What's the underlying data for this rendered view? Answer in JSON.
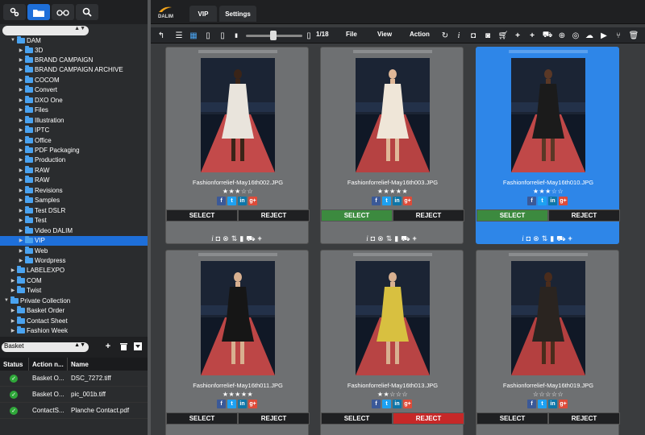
{
  "left_toolbar": {
    "icons": [
      "settings-icon",
      "folder-icon",
      "glasses-icon",
      "search-icon"
    ]
  },
  "tree": {
    "root_label": "DAM",
    "items": [
      {
        "label": "3D",
        "depth": 2
      },
      {
        "label": "BRAND CAMPAIGN",
        "depth": 2
      },
      {
        "label": "BRAND CAMPAIGN ARCHIVE",
        "depth": 2
      },
      {
        "label": "COCOM",
        "depth": 2
      },
      {
        "label": "Convert",
        "depth": 2
      },
      {
        "label": "DXO One",
        "depth": 2
      },
      {
        "label": "Files",
        "depth": 2
      },
      {
        "label": "Illustration",
        "depth": 2
      },
      {
        "label": "IPTC",
        "depth": 2
      },
      {
        "label": "Office",
        "depth": 2
      },
      {
        "label": "PDF Packaging",
        "depth": 2
      },
      {
        "label": "Production",
        "depth": 2
      },
      {
        "label": "RAW",
        "depth": 2
      },
      {
        "label": "RAW",
        "depth": 2
      },
      {
        "label": "Revisions",
        "depth": 2
      },
      {
        "label": "Samples",
        "depth": 2
      },
      {
        "label": "Test DSLR",
        "depth": 2
      },
      {
        "label": "Test",
        "depth": 2
      },
      {
        "label": "Video DALIM",
        "depth": 2
      },
      {
        "label": "VIP",
        "depth": 2,
        "selected": true
      },
      {
        "label": "Web",
        "depth": 2
      },
      {
        "label": "Wordpress",
        "depth": 2
      },
      {
        "label": "LABELEXPO",
        "depth": 1
      },
      {
        "label": "COM",
        "depth": 1
      },
      {
        "label": "Twist",
        "depth": 1
      },
      {
        "label": "Private Collection",
        "depth": 0,
        "open": true
      },
      {
        "label": "Basket Order",
        "depth": 1
      },
      {
        "label": "Contact Sheet",
        "depth": 1
      },
      {
        "label": "Fashion Week",
        "depth": 1
      }
    ]
  },
  "basket": {
    "select_value": "Basket",
    "columns": [
      "Status",
      "Action n...",
      "Name"
    ],
    "rows": [
      {
        "action": "Basket O...",
        "name": "DSC_7272.tiff"
      },
      {
        "action": "Basket O...",
        "name": "pic_001b.tiff"
      },
      {
        "action": "ContactS...",
        "name": "Planche Contact.pdf"
      }
    ]
  },
  "tabs": [
    {
      "label": "VIP"
    },
    {
      "label": "Settings"
    }
  ],
  "logo_text": "DALIM",
  "toolbar": {
    "page": "1/18",
    "menus": [
      "File",
      "View",
      "Action"
    ]
  },
  "cards": [
    {
      "file": "Fashionforrelief-May16th002.JPG",
      "rating": "★★★☆☆",
      "selected": false,
      "select_on": false,
      "reject_on": false,
      "dress": "#e9e4dc",
      "skin": "#3a2418",
      "bg": "#c34a4a"
    },
    {
      "file": "Fashionforrelief-May16th003.JPG",
      "rating": "★★★★★",
      "selected": false,
      "select_on": true,
      "reject_on": false,
      "dress": "#efe6d8",
      "skin": "#e0b898",
      "bg": "#b64242"
    },
    {
      "file": "Fashionforrelief-May16th010.JPG",
      "rating": "★★★☆☆",
      "selected": true,
      "select_on": true,
      "reject_on": false,
      "dress": "#1b1b1b",
      "skin": "#5a3826",
      "bg": "#c04848"
    },
    {
      "file": "Fashionforrelief-May16th011.JPG",
      "rating": "★★★★★",
      "selected": false,
      "select_on": false,
      "reject_on": false,
      "dress": "#161616",
      "skin": "#d8b090",
      "bg": "#bd4646"
    },
    {
      "file": "Fashionforrelief-May16th013.JPG",
      "rating": "★★☆☆☆",
      "selected": false,
      "select_on": false,
      "reject_on": true,
      "dress": "#d8c040",
      "skin": "#d8b090",
      "bg": "#b84444"
    },
    {
      "file": "Fashionforrelief-May16th019.JPG",
      "rating": "☆☆☆☆☆",
      "selected": false,
      "select_on": false,
      "reject_on": false,
      "dress": "#2a2420",
      "skin": "#4a2c1c",
      "bg": "#b44040"
    }
  ],
  "labels": {
    "select": "SELECT",
    "reject": "REJECT"
  },
  "social": [
    {
      "t": "f",
      "c": "#3b5998"
    },
    {
      "t": "t",
      "c": "#1da1f2"
    },
    {
      "t": "in",
      "c": "#0e76a8"
    },
    {
      "t": "g+",
      "c": "#dd4b39"
    }
  ]
}
